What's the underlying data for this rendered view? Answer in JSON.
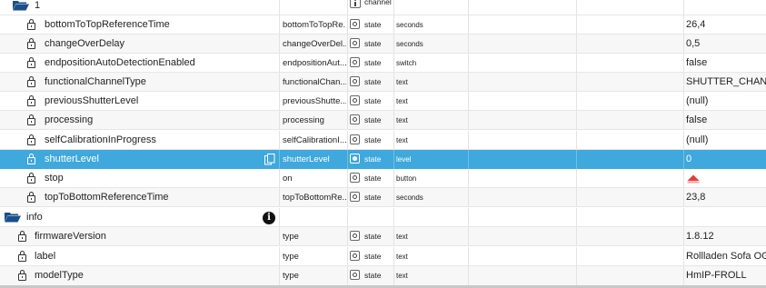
{
  "rows": [
    {
      "name": "1",
      "role": "",
      "type_label": "channel",
      "kind": "folder-channel"
    },
    {
      "name": "bottomToTopReferenceTime",
      "id": "bottomToTopRe...",
      "role": "state",
      "type": "seconds",
      "value": "26,4"
    },
    {
      "name": "changeOverDelay",
      "id": "changeOverDel...",
      "role": "state",
      "type": "seconds",
      "value": "0,5"
    },
    {
      "name": "endpositionAutoDetectionEnabled",
      "id": "endpositionAut...",
      "role": "state",
      "type": "switch",
      "value": "false"
    },
    {
      "name": "functionalChannelType",
      "id": "functionalChan...",
      "role": "state",
      "type": "text",
      "value": "SHUTTER_CHAN..."
    },
    {
      "name": "previousShutterLevel",
      "id": "previousShutte...",
      "role": "state",
      "type": "text",
      "value": "(null)"
    },
    {
      "name": "processing",
      "id": "processing",
      "role": "state",
      "type": "text",
      "value": "false"
    },
    {
      "name": "selfCalibrationInProgress",
      "id": "selfCalibrationI...",
      "role": "state",
      "type": "text",
      "value": "(null)"
    },
    {
      "name": "shutterLevel",
      "id": "shutterLevel",
      "role": "state",
      "type": "level",
      "value": "0",
      "selected": true
    },
    {
      "name": "stop",
      "id": "on",
      "role": "state",
      "type": "button",
      "value": ""
    },
    {
      "name": "topToBottomReferenceTime",
      "id": "topToBottomRe...",
      "role": "state",
      "type": "seconds",
      "value": "23,8"
    },
    {
      "name": "info",
      "kind": "folder-info"
    },
    {
      "name": "firmwareVersion",
      "id": "type",
      "role": "state",
      "type": "text",
      "value": "1.8.12"
    },
    {
      "name": "label",
      "id": "type",
      "role": "state",
      "type": "text",
      "value": "Rollladen Sofa OG"
    },
    {
      "name": "modelType",
      "id": "type",
      "role": "state",
      "type": "text",
      "value": "HmIP-FROLL"
    }
  ],
  "icons": {
    "folder": "folder-open-icon",
    "lock": "lock-icon",
    "info": "info-icon",
    "copy": "copy-icon",
    "stop": "triangle-up-red-icon",
    "channel": "channel-icon"
  },
  "colors": {
    "selected_row": "#3fa8dc",
    "folder": "#1a4f8a",
    "stop_button": "#e83a3a"
  }
}
